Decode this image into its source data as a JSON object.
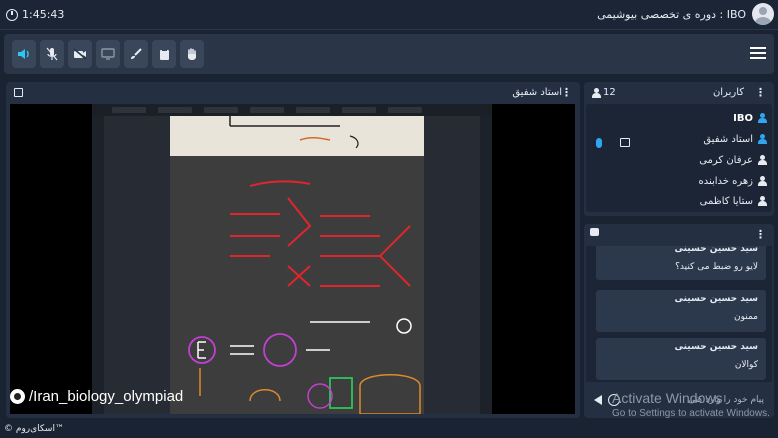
{
  "header": {
    "time": "1:45:43",
    "course_title": "IBO : دوره ی تخصصی بیوشیمی"
  },
  "toolbar": {
    "tools": [
      "speaker-icon",
      "mic-off-icon",
      "camera-off-icon",
      "monitor-icon",
      "brush-icon",
      "clipboard-icon",
      "hand-icon"
    ]
  },
  "presenter": {
    "title": "استاد شفیق"
  },
  "users": {
    "count": "12",
    "title": "کاربران",
    "list": [
      {
        "name": "IBO",
        "highlight": true
      },
      {
        "name": "استاد شفیق",
        "highlight": false
      },
      {
        "name": "عرفان کرمی",
        "highlight": false
      },
      {
        "name": "زهره خدابنده",
        "highlight": false
      },
      {
        "name": "ستایا کاظمی",
        "highlight": false
      }
    ]
  },
  "chat": {
    "messages": [
      {
        "name": "سید حسین حسینی",
        "text": "لایو رو ضبط می کنید؟"
      },
      {
        "name": "سید حسین حسینی",
        "text": "ممنون"
      },
      {
        "name": "سید حسین حسینی",
        "text": "کوالان"
      }
    ],
    "placeholder": "پیام خود را وارد کنی"
  },
  "watermark": "/Iran_biology_olympiad",
  "footer": "© اسکای‌روم™",
  "windows_notice": {
    "line1": "Activate Windows",
    "line2": "Go to Settings to activate Windows."
  },
  "colors": {
    "accent": "#2ea6f0",
    "panel": "#243042",
    "background": "#1a2332"
  }
}
